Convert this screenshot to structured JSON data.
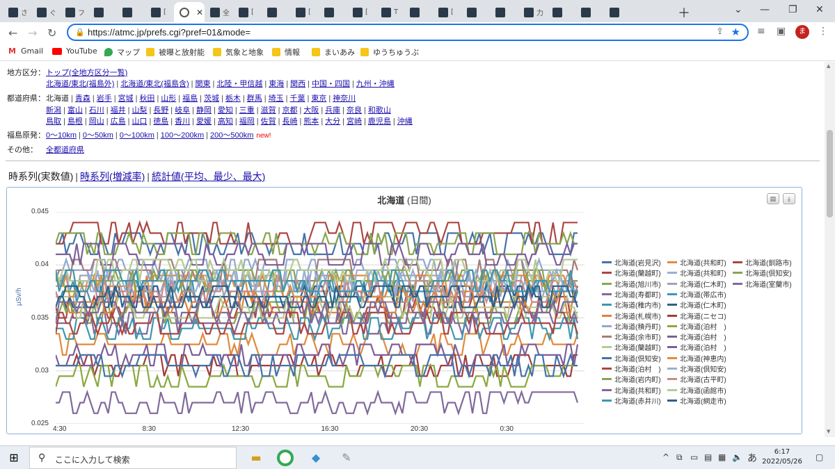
{
  "browser": {
    "tabs": [
      {
        "title": "さ"
      },
      {
        "title": "ぐ"
      },
      {
        "title": "フ"
      },
      {
        "title": ""
      },
      {
        "title": ""
      },
      {
        "title": "["
      },
      {
        "title": "",
        "active": true
      },
      {
        "title": "全"
      },
      {
        "title": "["
      },
      {
        "title": ""
      },
      {
        "title": "["
      },
      {
        "title": ""
      },
      {
        "title": "["
      },
      {
        "title": "T"
      },
      {
        "title": ""
      },
      {
        "title": "["
      },
      {
        "title": ""
      },
      {
        "title": ""
      },
      {
        "title": "力"
      },
      {
        "title": ""
      },
      {
        "title": ""
      },
      {
        "title": ""
      }
    ],
    "url": "https://atmc.jp/prefs.cgi?pref=01&mode=",
    "avatar": "ま",
    "bookmarks": [
      "Gmail",
      "YouTube",
      "マップ",
      "被曝と放射能",
      "気象と地象",
      "情報",
      "まいあみ",
      "ゆうちゅうぶ"
    ]
  },
  "nav": {
    "region_label": "地方区分：",
    "region_top": "トップ(全地方区分一覧)",
    "regions": [
      "北海道/東北(福島外)",
      "北海道/東北(福島含)",
      "関東",
      "北陸・甲信越",
      "東海",
      "関西",
      "中国・四国",
      "九州・沖縄"
    ],
    "pref_label": "都道府県：",
    "pref_current": "北海道",
    "prefs1": [
      "青森",
      "岩手",
      "宮城",
      "秋田",
      "山形",
      "福島",
      "茨城",
      "栃木",
      "群馬",
      "埼玉",
      "千葉",
      "東京",
      "神奈川"
    ],
    "prefs2": [
      "新潟",
      "富山",
      "石川",
      "福井",
      "山梨",
      "長野",
      "岐阜",
      "静岡",
      "愛知",
      "三重",
      "滋賀",
      "京都",
      "大阪",
      "兵庫",
      "奈良",
      "和歌山"
    ],
    "prefs3": [
      "鳥取",
      "島根",
      "岡山",
      "広島",
      "山口",
      "徳島",
      "香川",
      "愛媛",
      "高知",
      "福岡",
      "佐賀",
      "長崎",
      "熊本",
      "大分",
      "宮崎",
      "鹿児島",
      "沖縄"
    ],
    "fukushima_label": "福島原発：",
    "fukushima": [
      "0〜10km",
      "0〜50km",
      "0〜100km",
      "100〜200km",
      "200〜500km"
    ],
    "new_badge": "new!",
    "other_label": "その他：",
    "other": "全都道府県"
  },
  "views": {
    "current": "時系列(実数値)",
    "link1": "時系列(増減率)",
    "link2": "統計値(平均、最少、最大)"
  },
  "chart_data": {
    "type": "line",
    "title": "北海道",
    "subtitle": "(日間)",
    "ylabel": "μSv/h",
    "ylim": [
      0.025,
      0.045
    ],
    "yticks": [
      "0.045",
      "0.04",
      "0.035",
      "0.03",
      "0.025"
    ],
    "xticks": [
      "4:30",
      "8:30",
      "12:30",
      "16:30",
      "20:30",
      "0:30"
    ],
    "grid": true,
    "legend_position": "right",
    "series": [
      {
        "name": "北海道(岩見沢)",
        "color": "#4572a7",
        "base": 0.042
      },
      {
        "name": "北海道(共和町)",
        "color": "#e08a3c",
        "base": 0.0325
      },
      {
        "name": "北海道(釧路市)",
        "color": "#aa4643",
        "base": 0.036
      },
      {
        "name": "北海道(蘭越町)",
        "color": "#aa4643",
        "base": 0.043
      },
      {
        "name": "北海道(共和町)",
        "color": "#9aafd0",
        "base": 0.0385
      },
      {
        "name": "北海道(倶知安)",
        "color": "#89a54e",
        "base": 0.042
      },
      {
        "name": "北海道(旭川市)",
        "color": "#89a54e",
        "base": 0.0355
      },
      {
        "name": "北海道(仁木町)",
        "color": "#9fa3b8",
        "base": 0.038
      },
      {
        "name": "北海道(室蘭市)",
        "color": "#80699b",
        "base": 0.027
      },
      {
        "name": "北海道(寿都町)",
        "color": "#80699b",
        "base": 0.0345
      },
      {
        "name": "北海道(帯広市)",
        "color": "#3d96ae",
        "base": 0.0375
      },
      {
        "name": "北海道(稚内市)",
        "color": "#3d96ae",
        "base": 0.034
      },
      {
        "name": "北海道(仁木町)",
        "color": "#2e5f8a",
        "base": 0.037
      },
      {
        "name": "北海道(札幌市)",
        "color": "#db843d",
        "base": 0.0365
      },
      {
        "name": "北海道(ニセコ)",
        "color": "#a23b3b",
        "base": 0.0305
      },
      {
        "name": "北海道(積丹町)",
        "color": "#92a8cd",
        "base": 0.0395
      },
      {
        "name": "北海道(泊村　)",
        "color": "#8aa83f",
        "base": 0.0295
      },
      {
        "name": "北海道(余市町)",
        "color": "#a47d7c",
        "base": 0.0395
      },
      {
        "name": "北海道(泊村　)",
        "color": "#7d5e99",
        "base": 0.0315
      },
      {
        "name": "北海道(蘭越町)",
        "color": "#b5ca92",
        "base": 0.036
      },
      {
        "name": "北海道(泊村　)",
        "color": "#7d5e99",
        "base": 0.041
      },
      {
        "name": "北海道(倶知安)",
        "color": "#4572a7",
        "base": 0.0305
      },
      {
        "name": "北海道(神恵内)",
        "color": "#e08a3c",
        "base": 0.038
      },
      {
        "name": "北海道(泊村　)",
        "color": "#aa4643",
        "base": 0.0345
      },
      {
        "name": "北海道(倶知安)",
        "color": "#9aafd0",
        "base": 0.0385
      },
      {
        "name": "北海道(岩内町)",
        "color": "#89a54e",
        "base": 0.0385
      },
      {
        "name": "北海道(古平町)",
        "color": "#c98a8a",
        "base": 0.0375
      },
      {
        "name": "北海道(共和町)",
        "color": "#80699b",
        "base": 0.0355
      },
      {
        "name": "北海道(函館市)",
        "color": "#b5ca92",
        "base": 0.0395
      },
      {
        "name": "北海道(赤井川)",
        "color": "#3d96ae",
        "base": 0.0385
      },
      {
        "name": "北海道(網走市)",
        "color": "#2e5f8a",
        "base": 0.037
      }
    ]
  },
  "taskbar": {
    "search_placeholder": "ここに入力して検索",
    "time": "6:17",
    "date": "2022/05/26",
    "ime": "あ"
  }
}
